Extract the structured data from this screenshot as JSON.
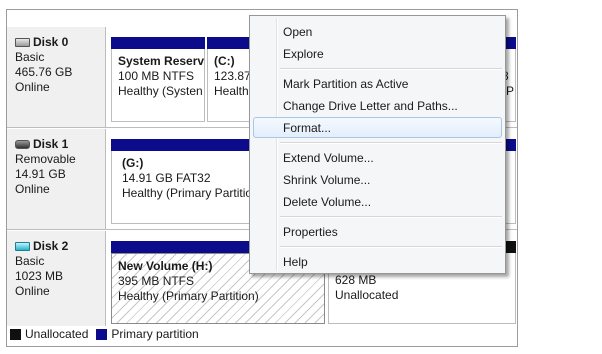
{
  "disks": [
    {
      "name": "Disk 0",
      "type": "Basic",
      "size": "465.76 GB",
      "status": "Online",
      "icon": "hard-disk-icon"
    },
    {
      "name": "Disk 1",
      "type": "Removable",
      "size": "14.91 GB",
      "status": "Online",
      "icon": "removable-disk-icon"
    },
    {
      "name": "Disk 2",
      "type": "Basic",
      "size": "1023 MB",
      "status": "Online",
      "icon": "virtual-disk-icon"
    }
  ],
  "partitions": {
    "p0a": {
      "name": "System Reserv",
      "detail": "100 MB NTFS",
      "status": "Healthy (Systen"
    },
    "p0b": {
      "name": "(C:)",
      "detail": "123.87",
      "status": "Health"
    },
    "p0c": {
      "detail": "8",
      "status": "(P"
    },
    "p1a": {
      "name": "(G:)",
      "detail": "14.91 GB FAT32",
      "status": "Healthy (Primary Partitio"
    },
    "p2a": {
      "name": "New Volume  (H:)",
      "detail": "395 MB NTFS",
      "status": "Healthy (Primary Partition)"
    },
    "p2b": {
      "detail": "628 MB",
      "status": "Unallocated"
    }
  },
  "legend": [
    {
      "label": "Unallocated",
      "color": "#101010"
    },
    {
      "label": "Primary partition",
      "color": "#0b0b8c"
    }
  ],
  "menu": {
    "items": {
      "open": "Open",
      "explore": "Explore",
      "mark_active": "Mark Partition as Active",
      "change_letter": "Change Drive Letter and Paths...",
      "format": "Format...",
      "extend": "Extend Volume...",
      "shrink": "Shrink Volume...",
      "delete": "Delete Volume...",
      "properties": "Properties",
      "help": "Help"
    },
    "highlighted": "format"
  },
  "colors": {
    "primary_bar": "#0b0b8c",
    "unallocated_bar": "#101010",
    "highlight": "#e3eefb"
  }
}
